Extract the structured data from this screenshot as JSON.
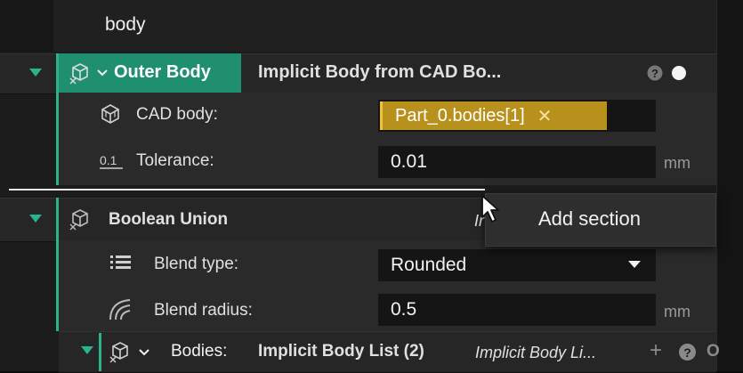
{
  "top": {
    "label": "body"
  },
  "outer_body": {
    "name": "Outer Body",
    "type": "Implicit Body from CAD Bo...",
    "cad_body_label": "CAD body:",
    "cad_body_value": "Part_0.bodies[1]",
    "tolerance_label": "Tolerance:",
    "tolerance_value": "0.01",
    "tolerance_unit": "mm",
    "help_icon": "help-icon",
    "status_icon": "status-dot-icon"
  },
  "boolean_union": {
    "name": "Boolean Union",
    "type_fragment": "Ir",
    "blend_type_label": "Blend type:",
    "blend_type_value": "Rounded",
    "blend_radius_label": "Blend radius:",
    "blend_radius_value": "0.5",
    "blend_radius_unit": "mm"
  },
  "context_menu": {
    "item": "Add section"
  },
  "bodies": {
    "label": "Bodies:",
    "list_name": "Implicit Body List (2)",
    "list_type": "Implicit Body Li...",
    "add_symbol": "+",
    "help_symbol": "?",
    "status_symbol": "O"
  },
  "colors": {
    "accent": "#2bb38e",
    "highlight": "#b8911d",
    "panel": "#1c1c1c"
  }
}
